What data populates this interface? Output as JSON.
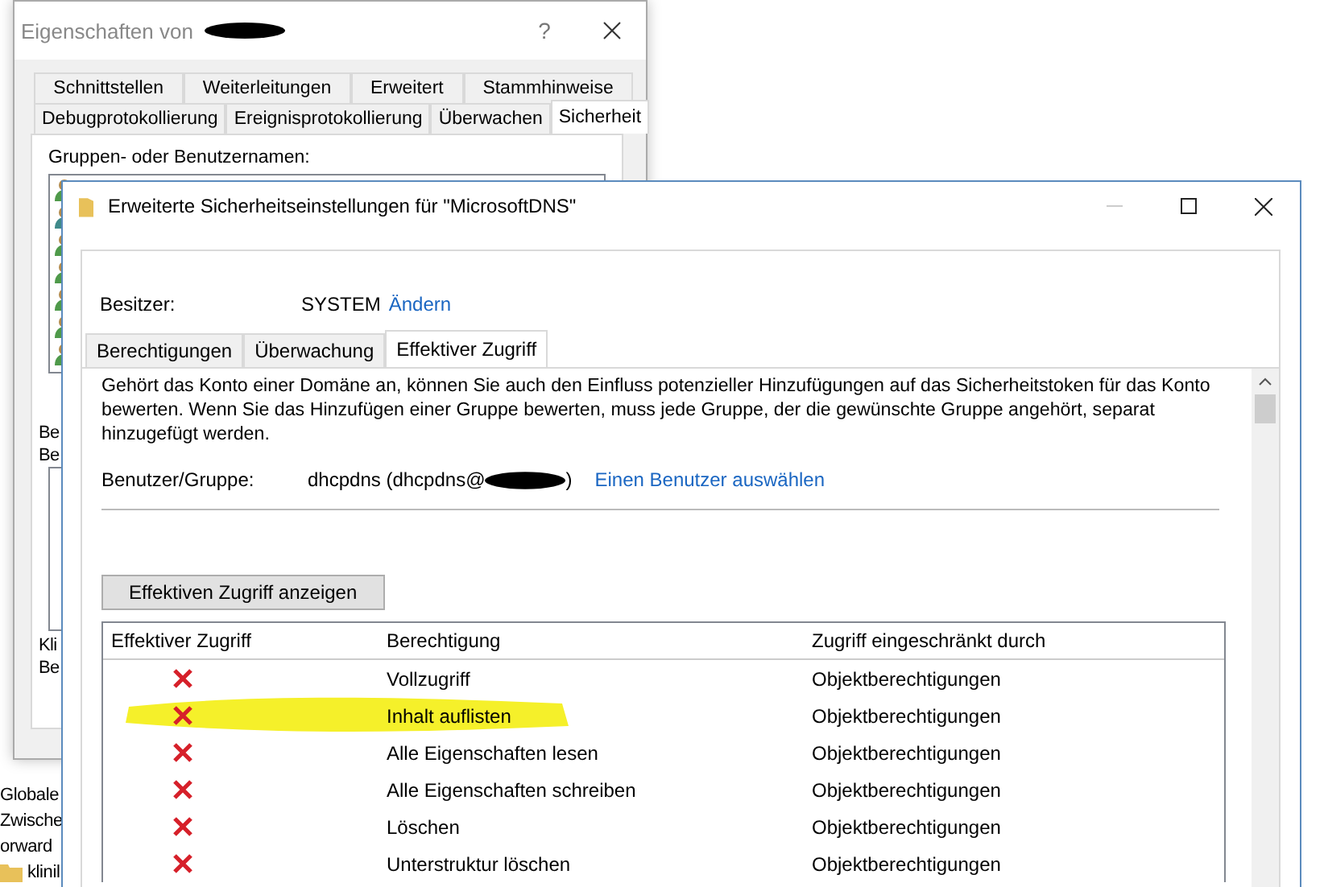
{
  "tree": [
    {
      "label": "Globale",
      "icon": false
    },
    {
      "label": "Zwische",
      "icon": false
    },
    {
      "label": "orward",
      "icon": false
    },
    {
      "label": "klinil",
      "icon": true
    }
  ],
  "back_window": {
    "title": "Eigenschaften von",
    "help": "?",
    "tab_rows": [
      [
        {
          "label": "Schnittstellen",
          "selected": false
        },
        {
          "label": "Weiterleitungen",
          "selected": false
        },
        {
          "label": "Erweitert",
          "selected": false
        },
        {
          "label": "Stammhinweise",
          "selected": false
        }
      ],
      [
        {
          "label": "Debugprotokollierung",
          "selected": false
        },
        {
          "label": "Ereignisprotokollierung",
          "selected": false
        },
        {
          "label": "Überwachen",
          "selected": false
        },
        {
          "label": "Sicherheit",
          "selected": true
        }
      ]
    ],
    "groups_label": "Gruppen- oder Benutzernamen:",
    "users": [
      {
        "kind": "user"
      },
      {
        "kind": "group"
      },
      {
        "kind": "user"
      },
      {
        "kind": "user"
      },
      {
        "kind": "user"
      },
      {
        "kind": "user"
      },
      {
        "kind": "user"
      }
    ],
    "cut_labels_top": [
      "Be",
      "Be"
    ],
    "cut_labels_bottom": [
      "Kli",
      "Be"
    ]
  },
  "front_window": {
    "title": "Erweiterte Sicherheitseinstellungen für \"MicrosoftDNS\"",
    "owner_label": "Besitzer:",
    "owner": "SYSTEM",
    "owner_link": "Ändern",
    "tabs": [
      {
        "label": "Berechtigungen",
        "selected": false
      },
      {
        "label": "Überwachung",
        "selected": false
      },
      {
        "label": "Effektiver Zugriff",
        "selected": true
      }
    ],
    "description": "Gehört das Konto einer Domäne an, können Sie auch den Einfluss potenzieller Hinzufügungen auf das Sicherheitstoken für das Konto bewerten. Wenn Sie das Hinzufügen einer Gruppe bewerten, muss jede Gruppe, der die gewünschte Gruppe angehört, separat hinzugefügt werden.",
    "user_label": "Benutzer/Gruppe:",
    "user_value": "dhcpdns (dhcpdns@",
    "user_value_end": ")",
    "user_link": "Einen Benutzer auswählen",
    "show_button": "Effektiven Zugriff anzeigen",
    "table": {
      "columns": [
        "Effektiver Zugriff",
        "Berechtigung",
        "Zugriff eingeschränkt durch"
      ],
      "rows": [
        {
          "allowed": false,
          "highlighted": false,
          "permission": "Vollzugriff",
          "limited_by": "Objektberechtigungen"
        },
        {
          "allowed": false,
          "highlighted": true,
          "permission": "Inhalt auflisten",
          "limited_by": "Objektberechtigungen"
        },
        {
          "allowed": false,
          "highlighted": false,
          "permission": "Alle Eigenschaften lesen",
          "limited_by": "Objektberechtigungen"
        },
        {
          "allowed": false,
          "highlighted": false,
          "permission": "Alle Eigenschaften schreiben",
          "limited_by": "Objektberechtigungen"
        },
        {
          "allowed": false,
          "highlighted": false,
          "permission": "Löschen",
          "limited_by": "Objektberechtigungen"
        },
        {
          "allowed": false,
          "highlighted": false,
          "permission": "Unterstruktur löschen",
          "limited_by": "Objektberechtigungen"
        }
      ]
    }
  }
}
